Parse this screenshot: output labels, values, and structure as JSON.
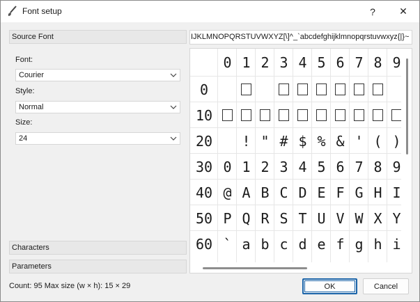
{
  "window": {
    "title": "Font setup",
    "help_label": "?",
    "close_label": "✕"
  },
  "sections": {
    "source_font": "Source Font",
    "characters": "Characters",
    "parameters": "Parameters"
  },
  "fields": {
    "font_label": "Font:",
    "font_value": "Courier",
    "style_label": "Style:",
    "style_value": "Normal",
    "size_label": "Size:",
    "size_value": "24"
  },
  "char_input": {
    "value": "IJKLMNOPQRSTUVWXYZ[\\]^_`abcdefghijklmnopqrstuvwxyz{|}~"
  },
  "grid": {
    "col_headers": [
      "0",
      "1",
      "2",
      "3",
      "4",
      "5",
      "6",
      "7",
      "8",
      "9"
    ],
    "rows": [
      {
        "header": "0",
        "cells": [
          "",
          "□",
          "",
          "□",
          "□",
          "□",
          "□",
          "□",
          "□",
          ""
        ]
      },
      {
        "header": "10",
        "cells": [
          "□",
          "□",
          "□",
          "□",
          "□",
          "□",
          "□",
          "□",
          "□",
          "□"
        ]
      },
      {
        "header": "20",
        "cells": [
          "",
          "!",
          "\"",
          "#",
          "$",
          "%",
          "&",
          "'",
          "(",
          ")"
        ]
      },
      {
        "header": "30",
        "cells": [
          "0",
          "1",
          "2",
          "3",
          "4",
          "5",
          "6",
          "7",
          "8",
          "9"
        ]
      },
      {
        "header": "40",
        "cells": [
          "@",
          "A",
          "B",
          "C",
          "D",
          "E",
          "F",
          "G",
          "H",
          "I"
        ]
      },
      {
        "header": "50",
        "cells": [
          "P",
          "Q",
          "R",
          "S",
          "T",
          "U",
          "V",
          "W",
          "X",
          "Y"
        ]
      },
      {
        "header": "60",
        "cells": [
          "`",
          "a",
          "b",
          "c",
          "d",
          "e",
          "f",
          "g",
          "h",
          "i"
        ]
      }
    ]
  },
  "status": {
    "text": "Count: 95  Max size (w × h): 15 × 29"
  },
  "buttons": {
    "ok": "OK",
    "cancel": "Cancel"
  }
}
